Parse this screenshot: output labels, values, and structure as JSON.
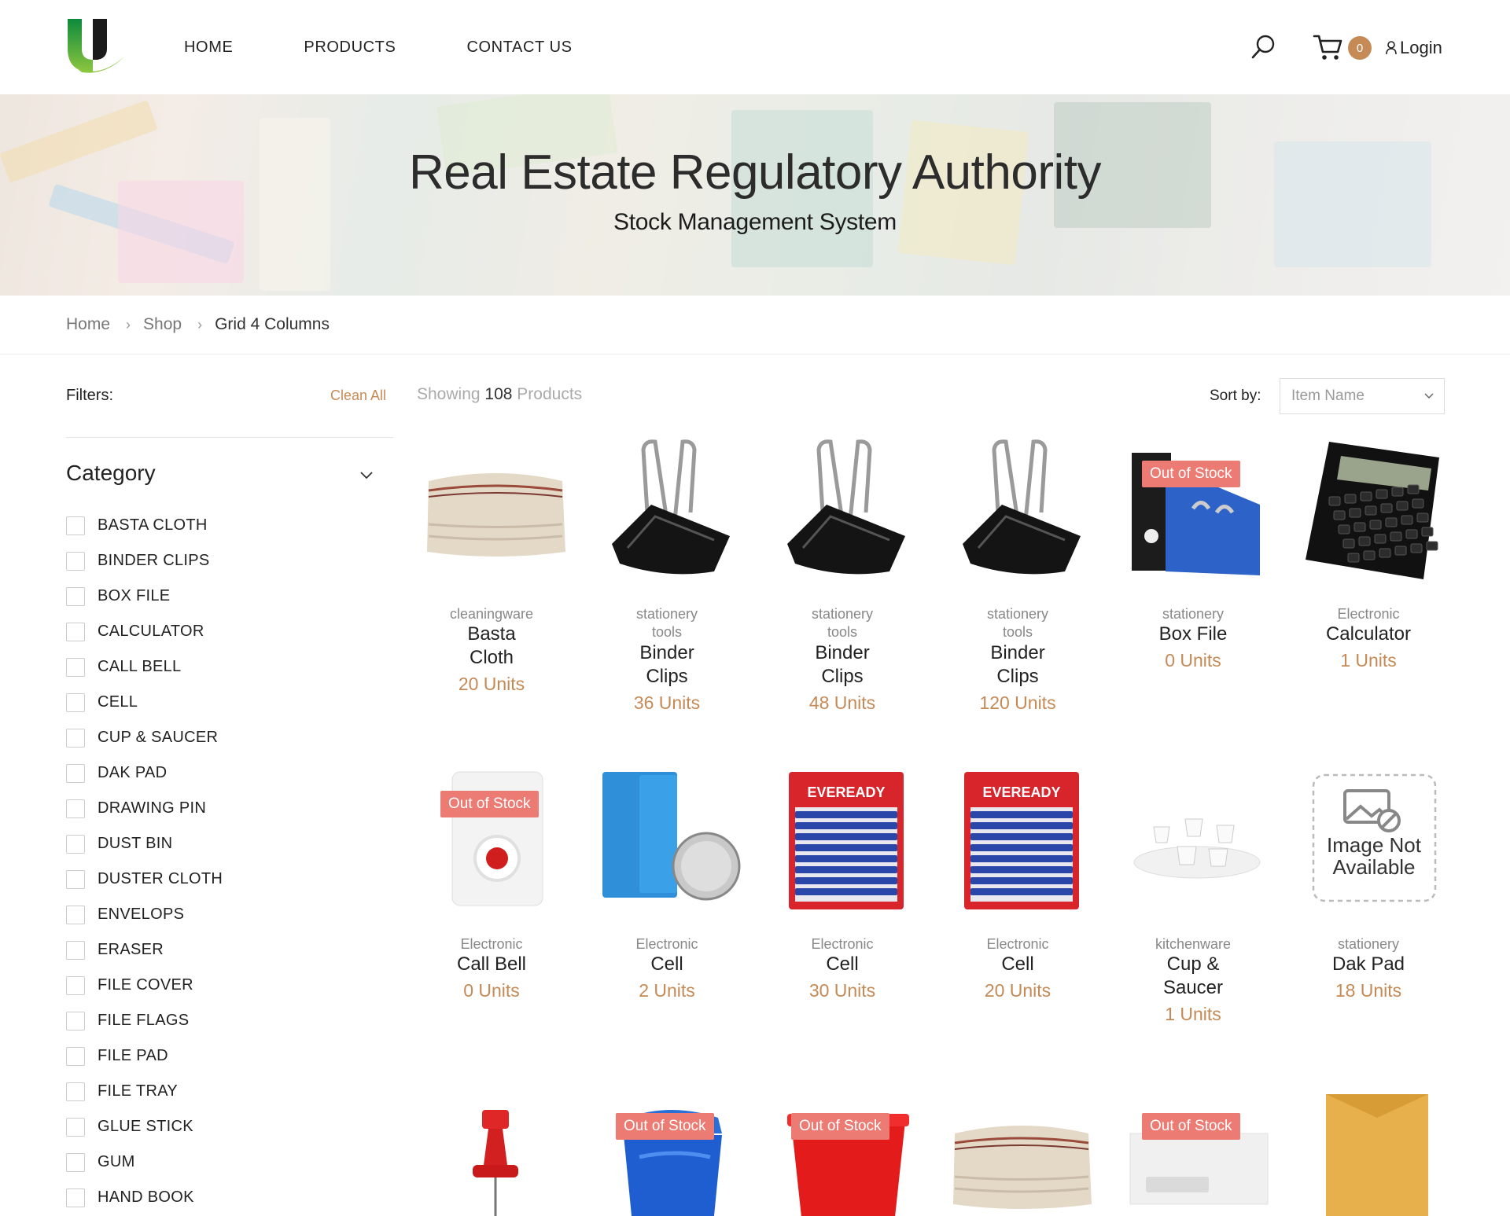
{
  "nav": {
    "home": "HOME",
    "products": "PRODUCTS",
    "contact": "CONTACT US"
  },
  "header": {
    "cart_count": "0",
    "login": "Login"
  },
  "hero": {
    "title": "Real Estate Regulatory Authority",
    "subtitle": "Stock Management System"
  },
  "breadcrumb": {
    "home": "Home",
    "shop": "Shop",
    "current": "Grid 4 Columns"
  },
  "filters": {
    "label": "Filters:",
    "clean_all": "Clean All",
    "category_title": "Category"
  },
  "categories": [
    "BASTA CLOTH",
    "BINDER CLIPS",
    "BOX FILE",
    "CALCULATOR",
    "CALL BELL",
    "CELL",
    "CUP & SAUCER",
    "DAK PAD",
    "DRAWING PIN",
    "DUST BIN",
    "DUSTER CLOTH",
    "ENVELOPS",
    "ERASER",
    "FILE COVER",
    "FILE FLAGS",
    "FILE PAD",
    "FILE TRAY",
    "GLUE STICK",
    "GUM",
    "HAND BOOK"
  ],
  "toolbar": {
    "showing_prefix": "Showing",
    "count": "108",
    "showing_suffix": "Products",
    "sort_label": "Sort by:",
    "sort_value": "Item Name"
  },
  "badge_text": "Out of Stock",
  "placeholder_text": {
    "line1": "Image Not",
    "line2": "Available"
  },
  "products": [
    {
      "cat1": "cleaningware",
      "cat2": "",
      "name1": "Basta",
      "name2": "Cloth",
      "units": "20 Units",
      "image": "cloth",
      "out_of_stock": false
    },
    {
      "cat1": "stationery",
      "cat2": "tools",
      "name1": "Binder",
      "name2": "Clips",
      "units": "36 Units",
      "image": "clip",
      "out_of_stock": false
    },
    {
      "cat1": "stationery",
      "cat2": "tools",
      "name1": "Binder",
      "name2": "Clips",
      "units": "48 Units",
      "image": "clip",
      "out_of_stock": false
    },
    {
      "cat1": "stationery",
      "cat2": "tools",
      "name1": "Binder",
      "name2": "Clips",
      "units": "120 Units",
      "image": "clip",
      "out_of_stock": false
    },
    {
      "cat1": "stationery",
      "cat2": "",
      "name1": "Box File",
      "name2": "",
      "units": "0 Units",
      "image": "boxfile",
      "out_of_stock": true
    },
    {
      "cat1": "Electronic",
      "cat2": "",
      "name1": "Calculator",
      "name2": "",
      "units": "1 Units",
      "image": "calculator",
      "out_of_stock": false
    },
    {
      "cat1": "Electronic",
      "cat2": "",
      "name1": "Call Bell",
      "name2": "",
      "units": "0 Units",
      "image": "bell",
      "out_of_stock": true
    },
    {
      "cat1": "Electronic",
      "cat2": "",
      "name1": "Cell",
      "name2": "",
      "units": "2 Units",
      "image": "coincell",
      "out_of_stock": false
    },
    {
      "cat1": "Electronic",
      "cat2": "",
      "name1": "Cell",
      "name2": "",
      "units": "30 Units",
      "image": "battery",
      "out_of_stock": false
    },
    {
      "cat1": "Electronic",
      "cat2": "",
      "name1": "Cell",
      "name2": "",
      "units": "20 Units",
      "image": "battery",
      "out_of_stock": false
    },
    {
      "cat1": "kitchenware",
      "cat2": "",
      "name1": "Cup &",
      "name2": "Saucer",
      "units": "1 Units",
      "image": "cups",
      "out_of_stock": false
    },
    {
      "cat1": "stationery",
      "cat2": "",
      "name1": "Dak Pad",
      "name2": "",
      "units": "18 Units",
      "image": "noimage",
      "out_of_stock": false
    },
    {
      "image": "pin",
      "out_of_stock": false
    },
    {
      "image": "bluebin",
      "out_of_stock": true
    },
    {
      "image": "redbin",
      "out_of_stock": true
    },
    {
      "image": "cloth",
      "out_of_stock": false
    },
    {
      "image": "envelope",
      "out_of_stock": true
    },
    {
      "image": "brownenv",
      "out_of_stock": false
    }
  ],
  "colors": {
    "accent": "#c58a55",
    "badge": "#ec7b73",
    "logo_green": "#7cc242",
    "logo_dark": "#1b1b1b"
  }
}
